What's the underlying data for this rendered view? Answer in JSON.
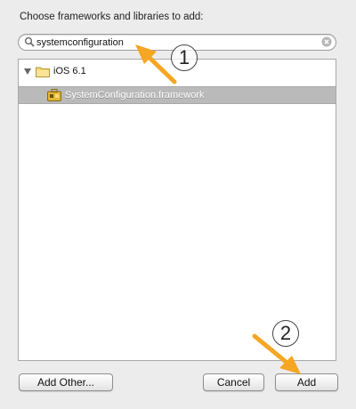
{
  "dialog": {
    "prompt": "Choose frameworks and libraries to add:"
  },
  "search": {
    "value": "systemconfiguration",
    "icon": "search-icon",
    "clear_icon": "clear-icon"
  },
  "list": {
    "group": {
      "label": "iOS 6.1",
      "icon": "folder-icon",
      "expanded": true
    },
    "items": [
      {
        "label": "SystemConfiguration.framework",
        "icon": "framework-icon",
        "selected": true
      }
    ]
  },
  "buttons": {
    "add_other": "Add Other...",
    "cancel": "Cancel",
    "add": "Add"
  },
  "callouts": [
    {
      "number": "1"
    },
    {
      "number": "2"
    }
  ],
  "colors": {
    "dialog_bg": "#ececec",
    "selection": "#bababa",
    "arrow": "#f5a623"
  }
}
